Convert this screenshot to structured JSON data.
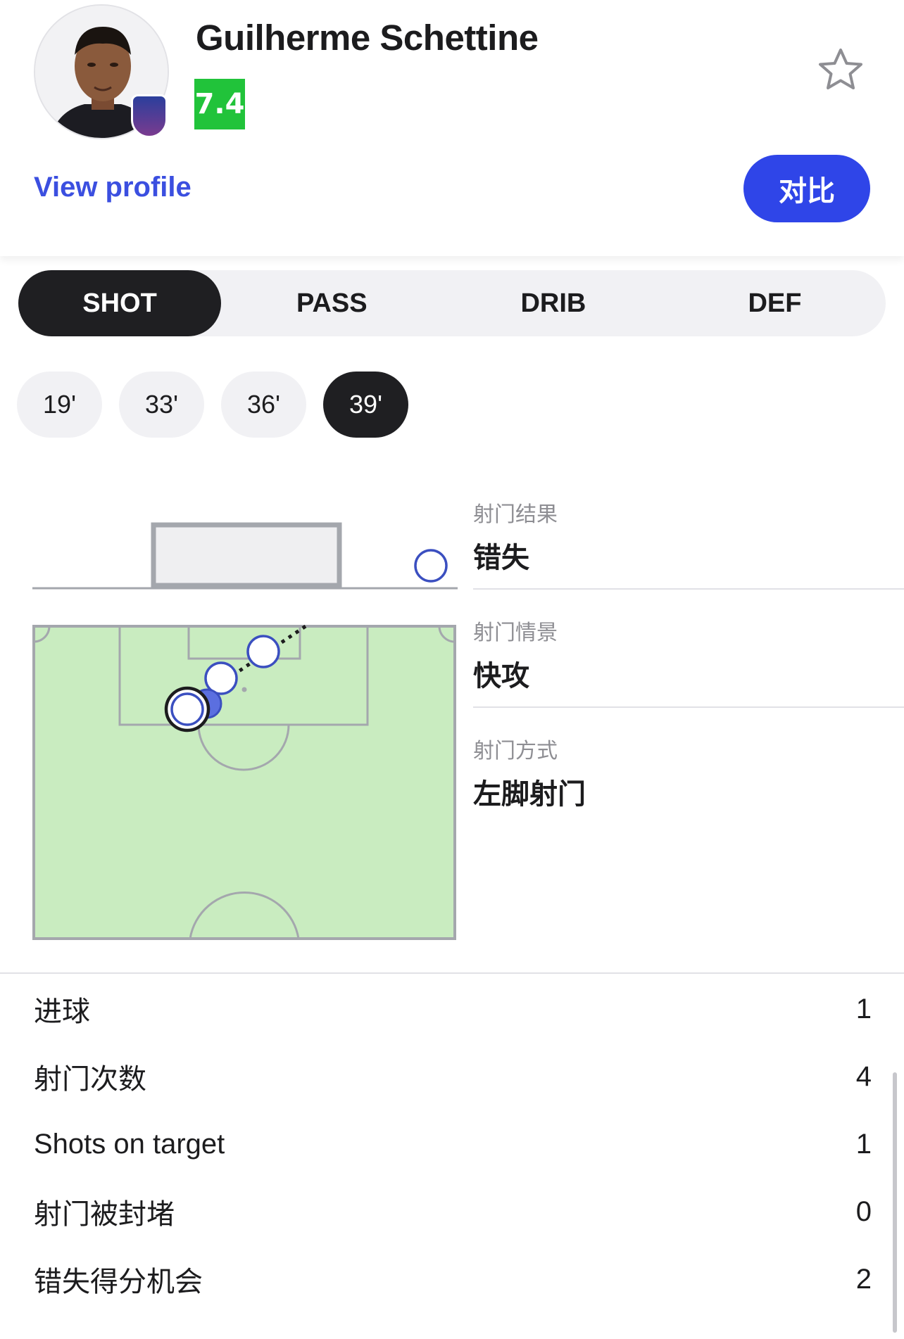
{
  "player": {
    "name": "Guilherme Schettine",
    "rating": "7.4",
    "view_profile_label": "View profile",
    "compare_label": "对比"
  },
  "icons": {
    "favorite": "star-outline-icon",
    "team": "team-badge-icon"
  },
  "colors": {
    "rating_green": "#21c33a",
    "accent_blue": "#2f45e8",
    "link_blue": "#3b4fe0",
    "pitch_green": "#c9ecc0",
    "tab_active": "#1f1f22"
  },
  "tabs": [
    {
      "label": "SHOT",
      "active": true
    },
    {
      "label": "PASS",
      "active": false
    },
    {
      "label": "DRIB",
      "active": false
    },
    {
      "label": "DEF",
      "active": false
    }
  ],
  "minutes": [
    {
      "label": "19'",
      "active": false
    },
    {
      "label": "33'",
      "active": false
    },
    {
      "label": "36'",
      "active": false
    },
    {
      "label": "39'",
      "active": true
    }
  ],
  "shot_details": [
    {
      "label": "射门结果",
      "value": "错失"
    },
    {
      "label": "射门情景",
      "value": "快攻"
    },
    {
      "label": "射门方式",
      "value": "左脚射门"
    }
  ],
  "stats": [
    {
      "label": "进球",
      "value": "1"
    },
    {
      "label": "射门次数",
      "value": "4"
    },
    {
      "label": "Shots on target",
      "value": "1"
    },
    {
      "label": "射门被封堵",
      "value": "0"
    },
    {
      "label": "错失得分机会",
      "value": "2"
    }
  ]
}
